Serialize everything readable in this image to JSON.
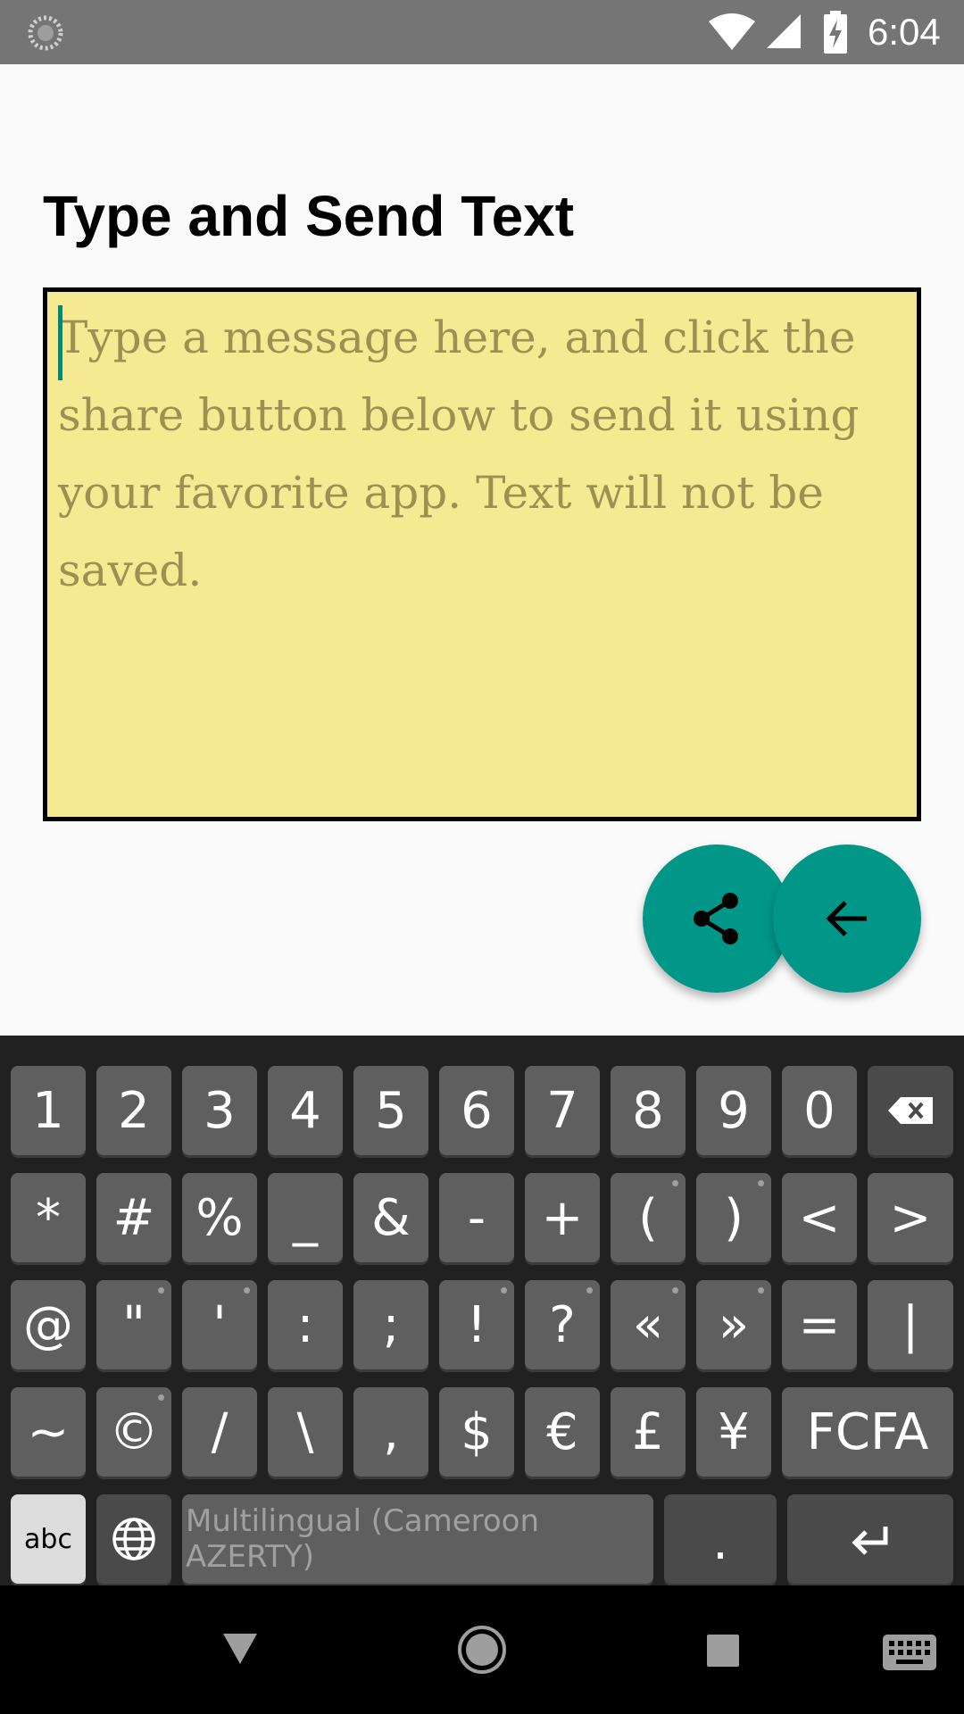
{
  "status_bar": {
    "time": "6:04",
    "icons": [
      "sync-icon",
      "wifi-icon",
      "cell-signal-icon",
      "battery-charging-icon"
    ]
  },
  "page": {
    "title": "Type and Send Text"
  },
  "message": {
    "value": "",
    "placeholder": "Type a message here, and click the share button below to send it using your favorite app. Text will not be saved."
  },
  "fabs": {
    "share_icon": "share-icon",
    "back_icon": "arrow-back-icon"
  },
  "colors": {
    "accent": "#009688",
    "note_background": "#f5ea91",
    "statusbar": "#757575"
  },
  "keyboard": {
    "row1": [
      "1",
      "2",
      "3",
      "4",
      "5",
      "6",
      "7",
      "8",
      "9",
      "0"
    ],
    "row2": [
      "*",
      "#",
      "%",
      "_",
      "&",
      "-",
      "+",
      "(",
      ")",
      "<",
      ">"
    ],
    "row3": [
      "@",
      "\"",
      "'",
      ":",
      ";",
      "!",
      "?",
      "«",
      "»",
      "=",
      "|"
    ],
    "row4": [
      "~",
      "©",
      "/",
      "\\",
      ",",
      "$",
      "€",
      "£",
      "¥",
      "FCFA"
    ],
    "abc_label": "abc",
    "space_label": "Multilingual (Cameroon AZERTY)",
    "period_label": "."
  },
  "navigation": {
    "icons": [
      "nav-back-icon",
      "nav-home-icon",
      "nav-recents-icon",
      "keyboard-switch-icon"
    ]
  }
}
